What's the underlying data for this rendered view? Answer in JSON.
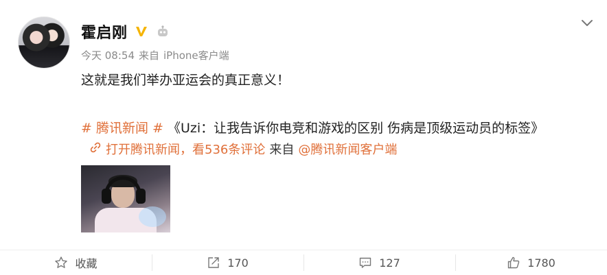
{
  "post": {
    "author": "霍启刚",
    "time": "今天 08:54",
    "source_prefix": "来自",
    "source": "iPhone客户端",
    "text": "这就是我们举办亚运会的真正意义！",
    "topic": "# 腾讯新闻 #",
    "headline": "《Uzi：让我告诉你电竞和游戏的区别 伤病是顶级运动员的标签》",
    "link_text": "打开腾讯新闻，看536条评论",
    "link_from": "来自",
    "link_source": "@腾讯新闻客户端"
  },
  "icons": {
    "verified": "verified-v-icon",
    "robot": "robot-icon",
    "menu": "chevron-down-icon",
    "link": "link-icon",
    "favorite": "star-icon",
    "repost": "share-icon",
    "comment": "comment-icon",
    "like": "thumbs-up-icon"
  },
  "colors": {
    "accent": "#e0703a",
    "verified": "#f5b400",
    "meta": "#8a8a8a"
  },
  "actions": {
    "favorite_label": "收藏",
    "repost_count": "170",
    "comment_count": "127",
    "like_count": "1780"
  }
}
